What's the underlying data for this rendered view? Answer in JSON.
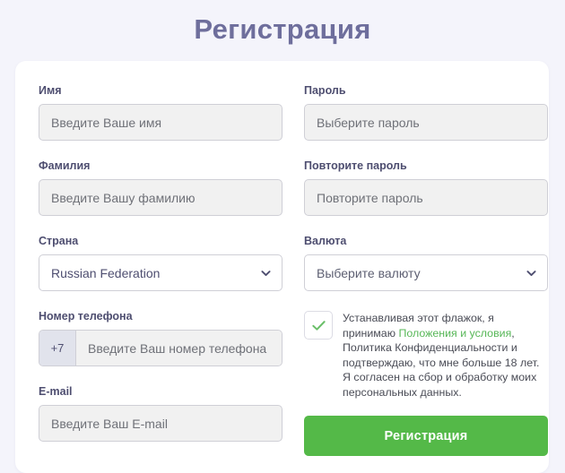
{
  "page": {
    "title": "Регистрация",
    "background_color": "#f4f4fb",
    "title_color": "#6e6e9c"
  },
  "form": {
    "left_column": {
      "first_name": {
        "label": "Имя",
        "placeholder": "Введите Ваше имя",
        "value": ""
      },
      "last_name": {
        "label": "Фамилия",
        "placeholder": "Введите Вашу фамилию",
        "value": ""
      },
      "country": {
        "label": "Страна",
        "selected": "Russian Federation",
        "icon": "chevron-down-icon"
      },
      "phone": {
        "label": "Номер телефона",
        "prefix": "+7",
        "placeholder": "Введите Ваш номер телефона",
        "value": ""
      },
      "email": {
        "label": "E-mail",
        "placeholder": "Введите Ваш E-mail",
        "value": ""
      }
    },
    "right_column": {
      "password": {
        "label": "Пароль",
        "placeholder": "Выберите пароль",
        "value": ""
      },
      "password_repeat": {
        "label": "Повторите пароль",
        "placeholder": "Повторите пароль",
        "value": ""
      },
      "currency": {
        "label": "Валюта",
        "selected": "Выберите валюту",
        "icon": "chevron-down-icon"
      },
      "consent": {
        "checked": true,
        "check_color": "#6abf69",
        "text_before_link": "Устанавливая этот флажок, я принимаю",
        "link_text": "Положения и условия",
        "link_color": "#57b757",
        "text_after_link": ", Политика Конфиденциальности и подтверждаю, что мне больше 18 лет. Я согласен на сбор и обработку моих персональных данных."
      },
      "submit": {
        "label": "Регистрация",
        "color": "#54b948"
      }
    }
  }
}
